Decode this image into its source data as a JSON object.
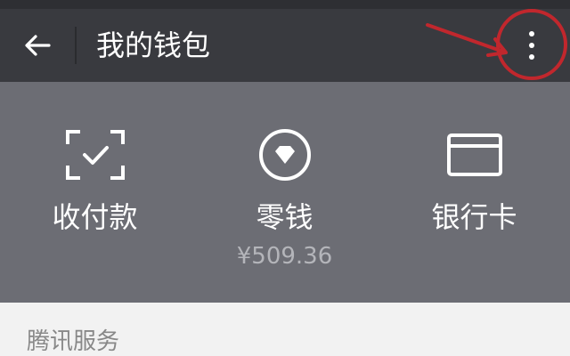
{
  "header": {
    "title": "我的钱包"
  },
  "wallet_items": [
    {
      "label": "收付款",
      "icon": "scan-pay-icon"
    },
    {
      "label": "零钱",
      "icon": "diamond-coin-icon",
      "balance": "¥509.36"
    },
    {
      "label": "银行卡",
      "icon": "bank-card-icon"
    }
  ],
  "services": {
    "title": "腾讯服务"
  },
  "colors": {
    "title_bar": "#393a3f",
    "panel": "#6c6d74",
    "annotation": "#c1272d"
  }
}
